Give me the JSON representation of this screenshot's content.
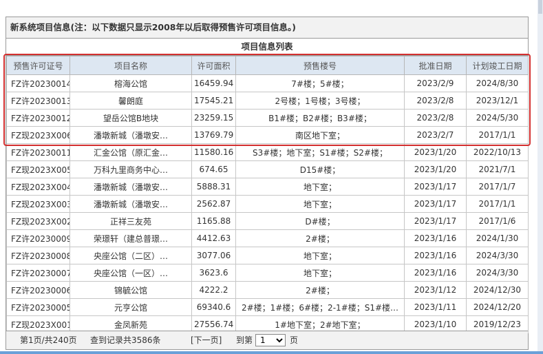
{
  "notice": "新系统项目信息(注：以下数据只显示2008年以后取得预售许可项目信息。)",
  "list_title": "项目信息列表",
  "columns": [
    "预售许可证号",
    "项目名称",
    "许可面积",
    "预售楼号",
    "批准日期",
    "计划竣工日期"
  ],
  "rows": [
    [
      "FZ许20230014",
      "榕海公馆",
      "16459.94",
      "7#楼；5#楼；",
      "2023/2/9",
      "2024/8/30"
    ],
    [
      "FZ许20230013",
      "馨朗庭",
      "17545.21",
      "2号楼；1号楼；3号楼；",
      "2023/2/8",
      "2023/12/1"
    ],
    [
      "FZ许20230012",
      "望岳公馆B地块",
      "23259.15",
      "B1#楼；B2#楼；B3#楼；",
      "2023/2/8",
      "2024/5/30"
    ],
    [
      "FZ现2023X006",
      "潘墩新城（潘墩安…",
      "13769.79",
      "南区地下室；",
      "2023/2/7",
      "2017/1/1"
    ],
    [
      "FZ许20230011",
      "汇金公馆（原汇金…",
      "11580.16",
      "S3#楼；地下室；S1#楼；S2#楼；",
      "2023/1/20",
      "2022/10/13"
    ],
    [
      "FZ现2023X005",
      "万科九里商务中心…",
      "674.65",
      "D15#楼；",
      "2023/1/20",
      "2021/7/1"
    ],
    [
      "FZ现2023X004",
      "潘墩新城（潘墩安…",
      "5888.31",
      "地下室；",
      "2023/1/17",
      "2017/1/7"
    ],
    [
      "FZ现2023X003",
      "潘墩新城（潘墩安…",
      "2562.87",
      "地下室；",
      "2023/1/17",
      "2017/1/1"
    ],
    [
      "FZ现2023X002",
      "正祥三友苑",
      "1165.88",
      "D#楼；",
      "2023/1/17",
      "2017/1/6"
    ],
    [
      "FZ许20230009",
      "荣璟轩（建总普璟…",
      "4412.63",
      "2#楼；",
      "2023/1/16",
      "2024/1/30"
    ],
    [
      "FZ许20230008",
      "央座公馆（二区）…",
      "3077.06",
      "地下室；",
      "2023/1/16",
      "2024/3/30"
    ],
    [
      "FZ许20230007",
      "央座公馆（一区）…",
      "3623.6",
      "地下室；",
      "2023/1/16",
      "2024/3/30"
    ],
    [
      "FZ许20230006",
      "锦毓公馆",
      "4222.2",
      "2#楼；",
      "2023/1/12",
      "2024/12/30"
    ],
    [
      "FZ许20230005",
      "元亨公馆",
      "69340.6",
      "2#楼；1#楼；6#楼；2-1#楼；S1#楼…",
      "2023/1/11",
      "2024/12/20"
    ],
    [
      "FZ现2023X001",
      "金凤新苑",
      "27556.74",
      "1#地下室；2#地下室；",
      "2023/1/10",
      "2019/12/23"
    ]
  ],
  "pager": {
    "page_info": "第1页/共240页",
    "total_records": "查到记录共3586条",
    "next_label": "[下一页]",
    "goto_label": "到第",
    "page_suffix": "页",
    "selected_page": "1"
  },
  "colors": {
    "header_bg": "#dde7f2",
    "highlight": "#d32f2f",
    "notice_bg": "#f2f2f2"
  }
}
